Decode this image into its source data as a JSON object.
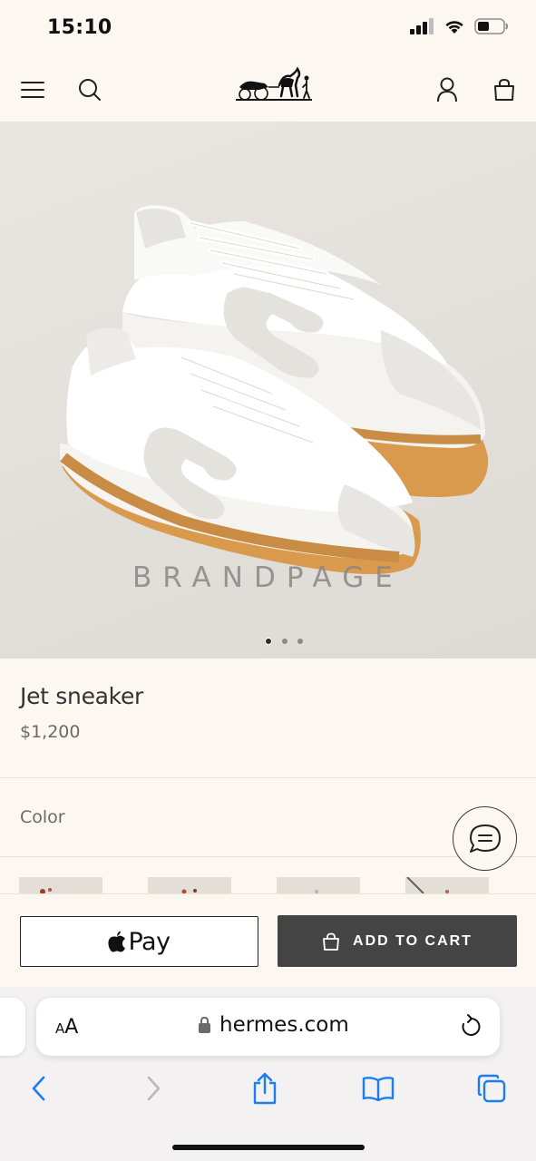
{
  "status_bar": {
    "time": "15:10",
    "icons": [
      "signal-icon",
      "wifi-icon",
      "battery-icon"
    ]
  },
  "header": {
    "icons": [
      "menu-icon",
      "search-icon",
      "hermes-logo",
      "account-icon",
      "shopping-bag-icon"
    ]
  },
  "hero": {
    "watermark": "BRANDPAGE",
    "carousel": {
      "count": 3,
      "active": 1
    }
  },
  "product": {
    "name": "Jet sneaker",
    "price": "$1,200",
    "color_label": "Color"
  },
  "actions": {
    "apple_pay_label": "Pay",
    "add_to_cart_label": "ADD TO CART"
  },
  "safari": {
    "aa_label_small": "A",
    "aa_label_large": "A",
    "url": "hermes.com",
    "toolbar_icons": [
      "back-icon",
      "forward-icon",
      "share-icon",
      "bookmarks-icon",
      "tabs-icon"
    ]
  },
  "colors": {
    "background": "#fcf7f1",
    "add_to_cart_bg": "#444444",
    "safari_blue": "#1a7df2",
    "sole": "#c88a3f"
  }
}
